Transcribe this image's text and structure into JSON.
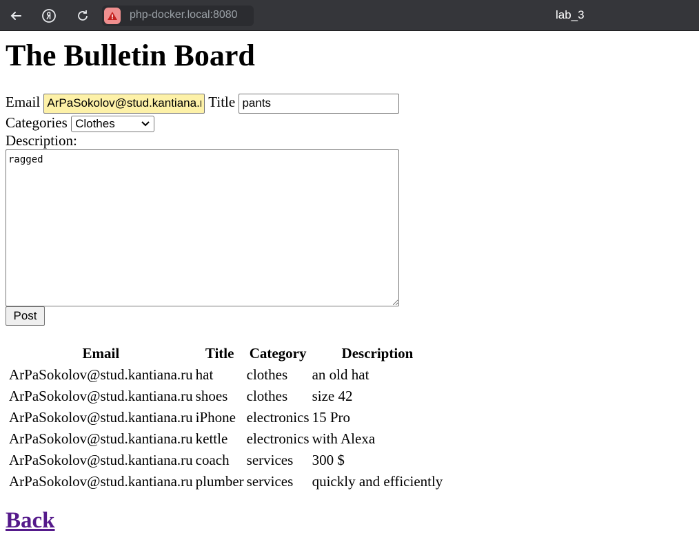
{
  "browser": {
    "url": "php-docker.local:8080",
    "tab_title": "lab_3"
  },
  "page": {
    "heading": "The Bulletin Board"
  },
  "form": {
    "email_label": "Email",
    "email_value": "ArPaSokolov@stud.kantiana.ru",
    "title_label": "Title",
    "title_value": "pants",
    "categories_label": "Categories",
    "category_selected": "Clothes",
    "description_label": "Description:",
    "description_value": "ragged",
    "post_label": "Post"
  },
  "table": {
    "headers": [
      "Email",
      "Title",
      "Category",
      "Description"
    ],
    "rows": [
      [
        "ArPaSokolov@stud.kantiana.ru",
        "hat",
        "clothes",
        "an old hat"
      ],
      [
        "ArPaSokolov@stud.kantiana.ru",
        "shoes",
        "clothes",
        "size 42"
      ],
      [
        "ArPaSokolov@stud.kantiana.ru",
        "iPhone",
        "electronics",
        "15 Pro"
      ],
      [
        "ArPaSokolov@stud.kantiana.ru",
        "kettle",
        "electronics",
        "with Alexa"
      ],
      [
        "ArPaSokolov@stud.kantiana.ru",
        "coach",
        "services",
        "300 $"
      ],
      [
        "ArPaSokolov@stud.kantiana.ru",
        "plumber",
        "services",
        "quickly and efficiently"
      ]
    ]
  },
  "links": {
    "back_label": "Back"
  },
  "colors": {
    "autofill_background": "#fdf1a8",
    "visited_link": "#551a8b",
    "browser_bar": "#35363a"
  }
}
